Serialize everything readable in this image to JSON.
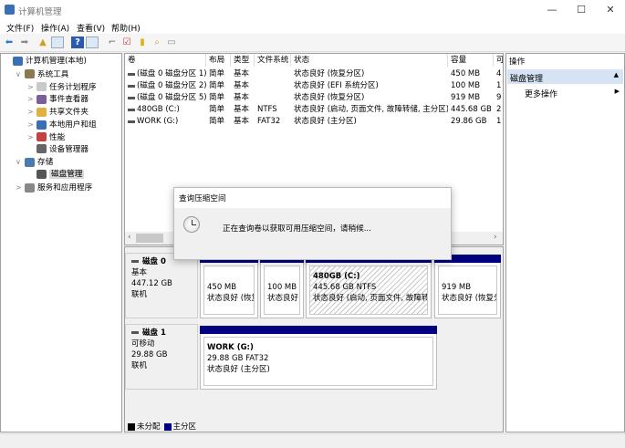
{
  "window": {
    "title": "计算机管理",
    "min": "—",
    "max": "☐",
    "close": "✕"
  },
  "menu": [
    "文件(F)",
    "操作(A)",
    "查看(V)",
    "帮助(H)"
  ],
  "tree": [
    {
      "label": "计算机管理(本地)",
      "level": 0,
      "arrow": "",
      "color": "#3a6fb5"
    },
    {
      "label": "系统工具",
      "level": 1,
      "arrow": "∨",
      "color": "#8a7a50"
    },
    {
      "label": "任务计划程序",
      "level": 2,
      "arrow": ">",
      "color": "#c9c9c9"
    },
    {
      "label": "事件查看器",
      "level": 2,
      "arrow": ">",
      "color": "#7a5f9a"
    },
    {
      "label": "共享文件夹",
      "level": 2,
      "arrow": ">",
      "color": "#e0b040"
    },
    {
      "label": "本地用户和组",
      "level": 2,
      "arrow": ">",
      "color": "#3a6fb5"
    },
    {
      "label": "性能",
      "level": 2,
      "arrow": ">",
      "color": "#c84040"
    },
    {
      "label": "设备管理器",
      "level": 2,
      "arrow": "",
      "color": "#666"
    },
    {
      "label": "存储",
      "level": 1,
      "arrow": "∨",
      "color": "#4a7ab0"
    },
    {
      "label": "磁盘管理",
      "level": 2,
      "arrow": "",
      "color": "#555",
      "selected": true
    },
    {
      "label": "服务和应用程序",
      "level": 1,
      "arrow": ">",
      "color": "#888"
    }
  ],
  "table": {
    "headers": [
      "卷",
      "布局",
      "类型",
      "文件系统",
      "状态",
      "容量",
      "可"
    ],
    "rows": [
      [
        "(磁盘 0 磁盘分区 1)",
        "简单",
        "基本",
        "",
        "状态良好 (恢复分区)",
        "450 MB",
        "4"
      ],
      [
        "(磁盘 0 磁盘分区 2)",
        "简单",
        "基本",
        "",
        "状态良好 (EFI 系统分区)",
        "100 MB",
        "1"
      ],
      [
        "(磁盘 0 磁盘分区 5)",
        "简单",
        "基本",
        "",
        "状态良好 (恢复分区)",
        "919 MB",
        "9"
      ],
      [
        "480GB (C:)",
        "简单",
        "基本",
        "NTFS",
        "状态良好 (启动, 页面文件, 故障转储, 主分区)",
        "445.68 GB",
        "2"
      ],
      [
        "WORK (G:)",
        "简单",
        "基本",
        "FAT32",
        "状态良好 (主分区)",
        "29.86 GB",
        "1"
      ]
    ]
  },
  "disks": [
    {
      "name": "磁盘 0",
      "type": "基本",
      "size": "447.12 GB",
      "status": "联机",
      "partitions": [
        {
          "title": "",
          "line1": "450 MB",
          "line2": "状态良好 (恢复"
        },
        {
          "title": "",
          "line1": "100 MB",
          "line2": "状态良好 ("
        },
        {
          "title": "480GB  (C:)",
          "line1": "445.68 GB NTFS",
          "line2": "状态良好 (启动, 页面文件, 故障转储",
          "selected": true
        },
        {
          "title": "",
          "line1": "919 MB",
          "line2": "状态良好 (恢复分"
        }
      ]
    },
    {
      "name": "磁盘 1",
      "type": "可移动",
      "size": "29.88 GB",
      "status": "联机",
      "partitions": [
        {
          "title": "WORK  (G:)",
          "line1": "29.88 GB FAT32",
          "line2": "状态良好 (主分区)"
        }
      ]
    }
  ],
  "legend": [
    {
      "label": "未分配",
      "color": "#000000"
    },
    {
      "label": "主分区",
      "color": "#000080"
    }
  ],
  "actions": {
    "header": "操作",
    "section": "磁盘管理",
    "item": "更多操作"
  },
  "dialog": {
    "title": "查询压缩空间",
    "message": "正在查询卷以获取可用压缩空间，请稍候..."
  }
}
